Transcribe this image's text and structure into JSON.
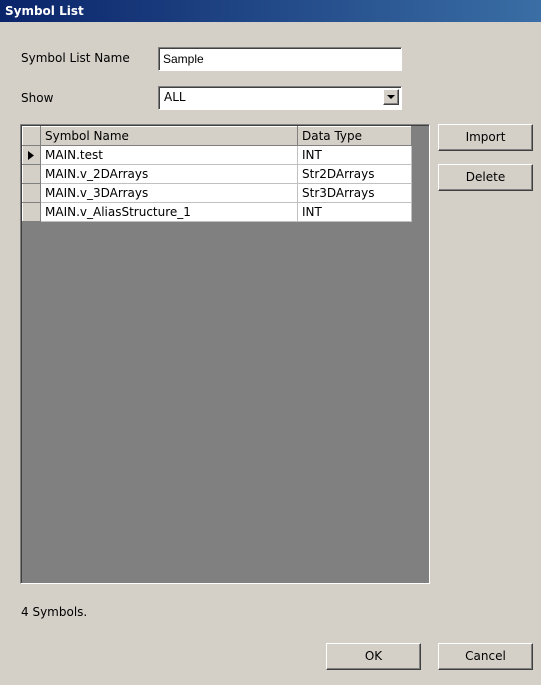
{
  "window": {
    "title": "Symbol List"
  },
  "form": {
    "name_label": "Symbol List Name",
    "name_value": "Sample",
    "show_label": "Show",
    "show_value": "ALL"
  },
  "table": {
    "columns": [
      "Symbol Name",
      "Data Type"
    ],
    "rows": [
      {
        "name": "MAIN.test",
        "type": "INT",
        "current": true
      },
      {
        "name": "MAIN.v_2DArrays",
        "type": "Str2DArrays",
        "current": false
      },
      {
        "name": "MAIN.v_3DArrays",
        "type": "Str3DArrays",
        "current": false
      },
      {
        "name": "MAIN.v_AliasStructure_1",
        "type": "INT",
        "current": false
      }
    ]
  },
  "side_buttons": {
    "import": "Import",
    "delete": "Delete"
  },
  "status": {
    "count_text": "4 Symbols."
  },
  "footer": {
    "ok": "OK",
    "cancel": "Cancel"
  },
  "icons": {
    "current_row": "row-pointer-icon",
    "dropdown": "chevron-down-icon"
  }
}
